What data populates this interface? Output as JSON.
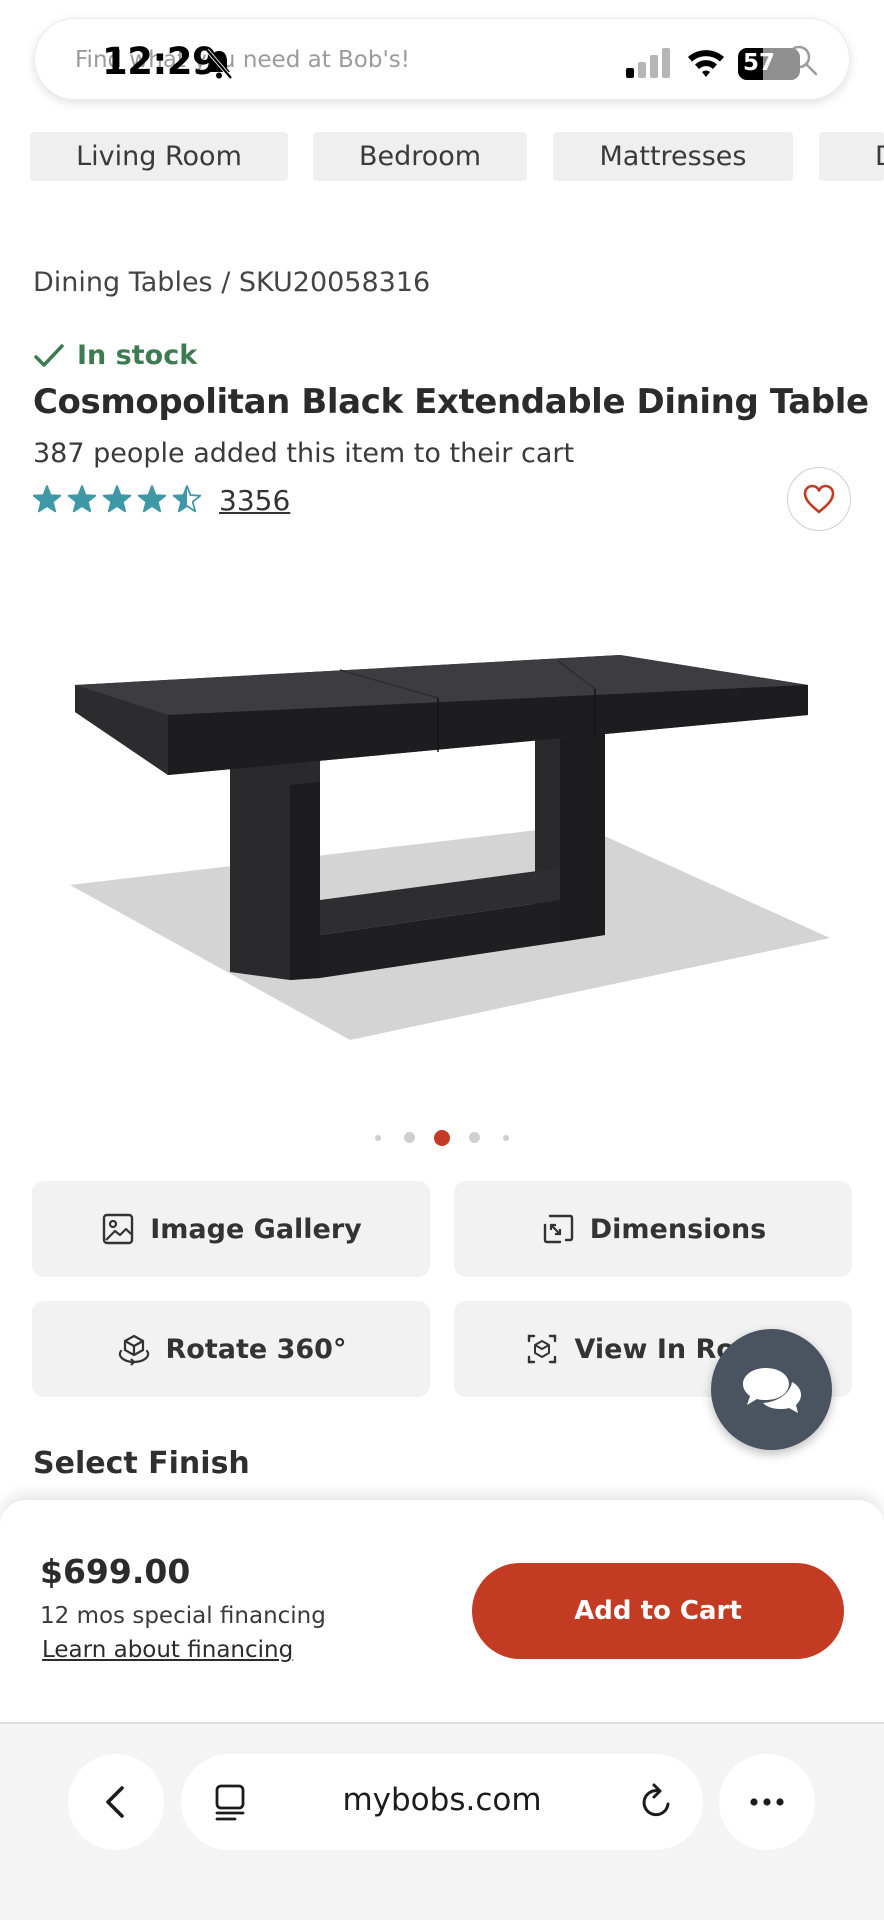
{
  "status_bar": {
    "time": "12:29",
    "battery": "57",
    "battery_level": 0.57
  },
  "search": {
    "placeholder": "Find what you need at Bob's!"
  },
  "categories": [
    "Living Room",
    "Bedroom",
    "Mattresses",
    "Dining"
  ],
  "breadcrumb": "Dining Tables /  SKU20058316",
  "product": {
    "stock_status": "In stock",
    "title": "Cosmopolitan Black Extendable Dining Table",
    "cart_count_text": "387 people added this item to their cart",
    "rating": 4.5,
    "rating_max": 5,
    "review_count": "3356"
  },
  "carousel": {
    "total": 5,
    "active_index": 2
  },
  "actions": {
    "image_gallery": "Image Gallery",
    "dimensions": "Dimensions",
    "rotate": "Rotate 360°",
    "view_in_room": "View In Room"
  },
  "select_finish": "Select Finish",
  "purchase": {
    "price": "$699.00",
    "financing": "12 mos special financing",
    "financing_link": "Learn about financing",
    "add_to_cart": "Add to Cart"
  },
  "browser": {
    "url": "mybobs.com"
  },
  "colors": {
    "brand_red": "#c23b22",
    "stock_green": "#3d7c52",
    "star_teal": "#3f98a6",
    "chat_fab": "#4a5360"
  }
}
